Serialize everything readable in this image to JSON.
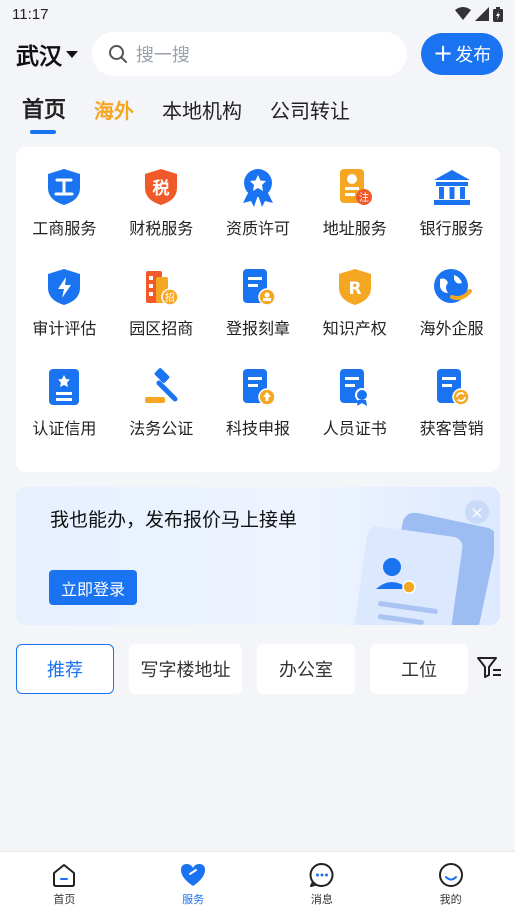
{
  "status_bar": {
    "time": "11:17"
  },
  "header": {
    "city": "武汉",
    "search_placeholder": "搜一搜",
    "publish_label": "发布"
  },
  "tabs": [
    {
      "label": "首页",
      "active": true
    },
    {
      "label": "海外",
      "highlight": true
    },
    {
      "label": "本地机构"
    },
    {
      "label": "公司转让"
    }
  ],
  "services": [
    {
      "label": "工商服务",
      "icon": "gongshang-icon"
    },
    {
      "label": "财税服务",
      "icon": "tax-icon"
    },
    {
      "label": "资质许可",
      "icon": "award-icon"
    },
    {
      "label": "地址服务",
      "icon": "address-icon"
    },
    {
      "label": "银行服务",
      "icon": "bank-icon"
    },
    {
      "label": "审计评估",
      "icon": "audit-shield-icon"
    },
    {
      "label": "园区招商",
      "icon": "park-building-icon"
    },
    {
      "label": "登报刻章",
      "icon": "stamp-doc-icon"
    },
    {
      "label": "知识产权",
      "icon": "trademark-shield-icon"
    },
    {
      "label": "海外企服",
      "icon": "globe-icon"
    },
    {
      "label": "认证信用",
      "icon": "certification-icon"
    },
    {
      "label": "法务公证",
      "icon": "gavel-icon"
    },
    {
      "label": "科技申报",
      "icon": "upload-doc-icon"
    },
    {
      "label": "人员证书",
      "icon": "badge-doc-icon"
    },
    {
      "label": "获客营销",
      "icon": "refresh-doc-icon"
    }
  ],
  "banner": {
    "title": "我也能办，发布报价马上接单",
    "button_label": "立即登录",
    "close_symbol": "×"
  },
  "filters": [
    {
      "label": "推荐",
      "active": true
    },
    {
      "label": "写字楼地址"
    },
    {
      "label": "办公室"
    },
    {
      "label": "工位"
    }
  ],
  "bottom_nav": [
    {
      "label": "首页",
      "icon": "home-icon"
    },
    {
      "label": "服务",
      "icon": "heart-icon",
      "active": true
    },
    {
      "label": "消息",
      "icon": "message-icon"
    },
    {
      "label": "我的",
      "icon": "profile-icon"
    }
  ],
  "colors": {
    "accent": "#1a73f0",
    "orange": "#f5a623",
    "background": "#f3f5f9"
  }
}
